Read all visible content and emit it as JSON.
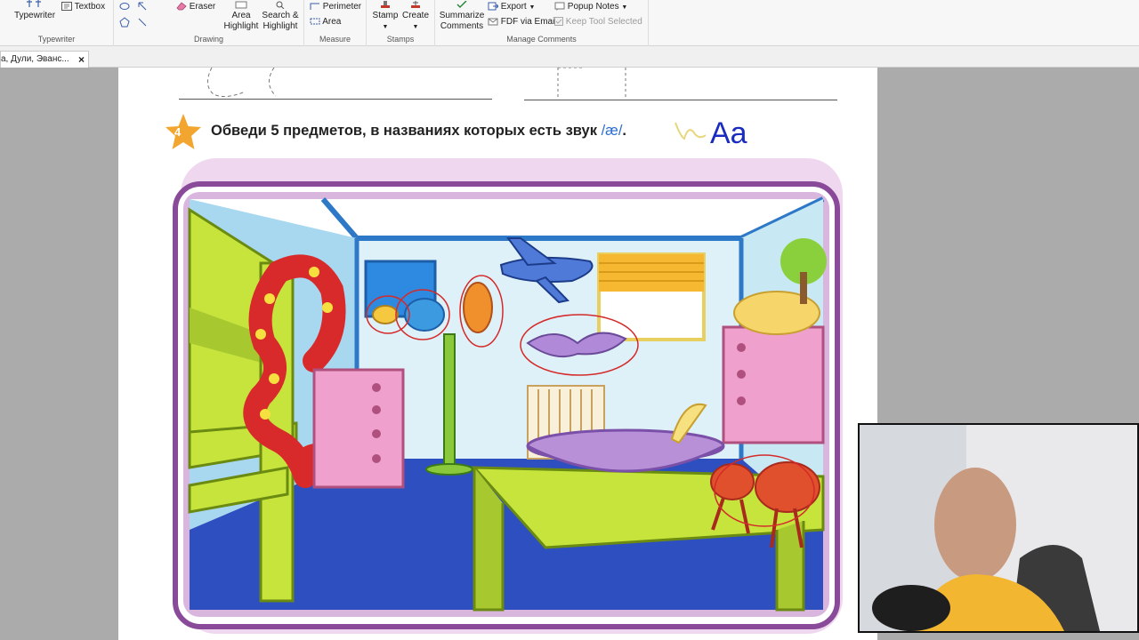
{
  "ribbon": {
    "groups": {
      "typewriter": "Typewriter",
      "drawing": "Drawing",
      "measure": "Measure",
      "stamps": "Stamps",
      "manage_comments": "Manage Comments"
    },
    "tools": {
      "typewriter": "Typewriter",
      "textbox": "Textbox",
      "eraser": "Eraser",
      "area_highlight": [
        "Area",
        "Highlight"
      ],
      "search_highlight": [
        "Search &",
        "Highlight"
      ],
      "perimeter": "Perimeter",
      "area": "Area",
      "stamp": "Stamp",
      "create": "Create",
      "summarize": [
        "Summarize",
        "Comments"
      ],
      "export": "Export",
      "fdf_via_email": "FDF via Email",
      "popup_notes": "Popup Notes",
      "keep_tool_selected": "Keep Tool Selected"
    }
  },
  "tab": {
    "title": "а, Дули, Эванс...",
    "close": "×"
  },
  "document": {
    "task_number": "4",
    "task_text": "Обведи 5 предметов, в названиях которых есть звук",
    "phoneme": "/æ/",
    "dot": ".",
    "annotation_text": "Aa"
  },
  "colors": {
    "frame_purple": "#8a4a9a",
    "annotation_red": "#d42a2a",
    "annotation_blue": "#1a2bbf",
    "star_orange": "#f2a630"
  }
}
